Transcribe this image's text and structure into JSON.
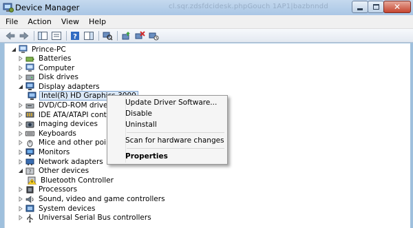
{
  "window": {
    "title": "Device Manager",
    "ghost_url": "cl.sqr.zdsfdcidesk.phpGouch 1AP1|bazbnndd"
  },
  "menubar": [
    "File",
    "Action",
    "View",
    "Help"
  ],
  "toolbar": {
    "buttons": [
      "back-icon",
      "forward-icon",
      "show-hide-console-tree-icon",
      "properties-icon",
      "help-icon",
      "show-hide-action-pane-icon",
      "scan-hardware-icon",
      "update-driver-icon",
      "uninstall-icon",
      "disable-icon"
    ]
  },
  "tree": {
    "root": "Prince-PC",
    "items": [
      {
        "label": "Batteries",
        "icon": "battery-icon",
        "expanded": false
      },
      {
        "label": "Computer",
        "icon": "computer-icon",
        "expanded": false
      },
      {
        "label": "Disk drives",
        "icon": "disk-drive-icon",
        "expanded": false
      },
      {
        "label": "Display adapters",
        "icon": "display-adapter-icon",
        "expanded": true
      },
      {
        "label": "Intel(R) HD Graphics 3000",
        "icon": "display-adapter-icon",
        "child": true,
        "selected": true
      },
      {
        "label": "DVD/CD-ROM drives",
        "icon": "dvd-drive-icon",
        "expanded": false
      },
      {
        "label": "IDE ATA/ATAPI controller",
        "icon": "ide-controller-icon",
        "expanded": false
      },
      {
        "label": "Imaging devices",
        "icon": "camera-icon",
        "expanded": false
      },
      {
        "label": "Keyboards",
        "icon": "keyboard-icon",
        "expanded": false
      },
      {
        "label": "Mice and other pointing d",
        "icon": "mouse-icon",
        "expanded": false
      },
      {
        "label": "Monitors",
        "icon": "monitor-icon",
        "expanded": false
      },
      {
        "label": "Network adapters",
        "icon": "network-adapter-icon",
        "expanded": false
      },
      {
        "label": "Other devices",
        "icon": "unknown-device-icon",
        "expanded": true
      },
      {
        "label": "Bluetooth Controller",
        "icon": "warning-device-icon",
        "child": true
      },
      {
        "label": "Processors",
        "icon": "processor-icon",
        "expanded": false
      },
      {
        "label": "Sound, video and game controllers",
        "icon": "sound-icon",
        "expanded": false
      },
      {
        "label": "System devices",
        "icon": "system-device-icon",
        "expanded": false
      },
      {
        "label": "Universal Serial Bus controllers",
        "icon": "usb-icon",
        "expanded": false
      }
    ]
  },
  "context_menu": {
    "items": [
      {
        "label": "Update Driver Software...",
        "bold": false
      },
      {
        "label": "Disable",
        "bold": false
      },
      {
        "label": "Uninstall",
        "bold": false
      },
      {
        "separator": true
      },
      {
        "label": "Scan for hardware changes",
        "bold": false
      },
      {
        "separator": true
      },
      {
        "label": "Properties",
        "bold": true
      }
    ]
  },
  "colors": {
    "titlebar": "#b9d1ea",
    "selection": "#dce9f7",
    "close_button": "#c6452f"
  }
}
